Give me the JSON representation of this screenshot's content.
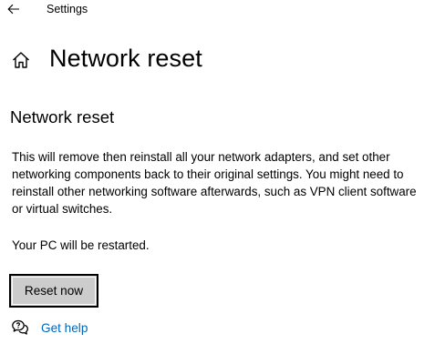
{
  "window": {
    "title": "Settings"
  },
  "header": {
    "page_title": "Network reset"
  },
  "section": {
    "title": "Network reset",
    "description": "This will remove then reinstall all your network adapters, and set other networking components back to their original settings. You might need to reinstall other networking software afterwards, such as VPN client software or virtual switches.",
    "restart_note": "Your PC will be restarted.",
    "reset_button_label": "Reset now"
  },
  "help": {
    "link_label": "Get help"
  },
  "icons": {
    "back": "back-arrow-icon",
    "home": "home-icon",
    "help": "chat-help-icon"
  },
  "colors": {
    "link": "#0067b8",
    "button_bg": "#cccccc",
    "button_border": "#000000",
    "background": "#ffffff"
  }
}
